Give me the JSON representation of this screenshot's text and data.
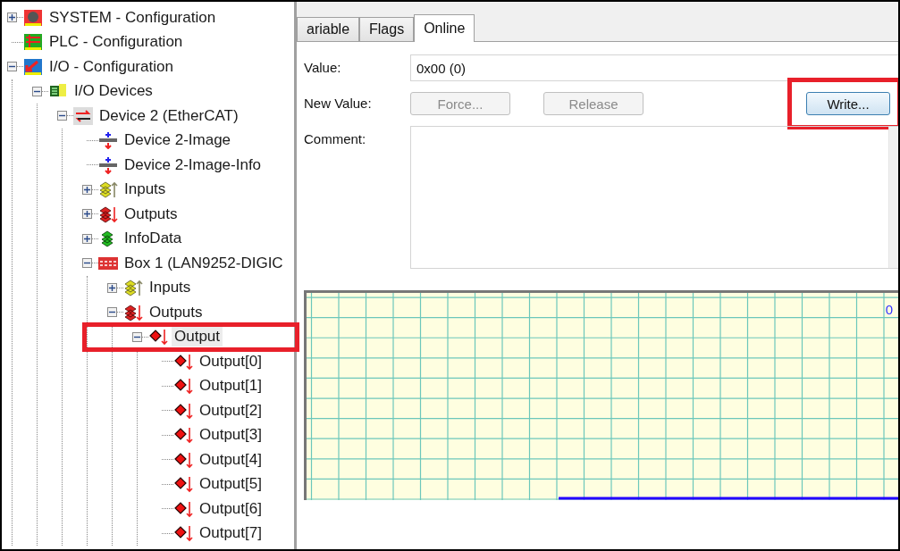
{
  "tree": [
    {
      "label": "SYSTEM - Configuration",
      "kind": "system",
      "expanded": false,
      "selected": false
    },
    {
      "label": "PLC - Configuration",
      "kind": "plc",
      "selected": false
    },
    {
      "label": "I/O - Configuration",
      "kind": "io",
      "expanded": true,
      "selected": false,
      "children": [
        {
          "label": "I/O Devices",
          "kind": "devices",
          "expanded": true,
          "selected": false,
          "children": [
            {
              "label": "Device 2 (EtherCAT)",
              "kind": "ethercat",
              "expanded": true,
              "selected": false,
              "children": [
                {
                  "label": "Device 2-Image",
                  "kind": "image",
                  "selected": false
                },
                {
                  "label": "Device 2-Image-Info",
                  "kind": "image",
                  "selected": false
                },
                {
                  "label": "Inputs",
                  "kind": "inputs",
                  "expanded": false,
                  "selected": false
                },
                {
                  "label": "Outputs",
                  "kind": "outputs",
                  "expanded": false,
                  "selected": false
                },
                {
                  "label": "InfoData",
                  "kind": "infodata",
                  "expanded": false,
                  "selected": false
                },
                {
                  "label": "Box 1 (LAN9252-DIGIC",
                  "kind": "box",
                  "expanded": true,
                  "selected": false,
                  "children": [
                    {
                      "label": "Inputs",
                      "kind": "inputs",
                      "expanded": false,
                      "selected": false
                    },
                    {
                      "label": "Outputs",
                      "kind": "outputs",
                      "expanded": true,
                      "selected": false,
                      "children": [
                        {
                          "label": "Output",
                          "kind": "output-group",
                          "expanded": true,
                          "selected": true,
                          "highlighted": true,
                          "children": [
                            {
                              "label": "Output[0]",
                              "kind": "output-var",
                              "selected": false
                            },
                            {
                              "label": "Output[1]",
                              "kind": "output-var",
                              "selected": false
                            },
                            {
                              "label": "Output[2]",
                              "kind": "output-var",
                              "selected": false
                            },
                            {
                              "label": "Output[3]",
                              "kind": "output-var",
                              "selected": false
                            },
                            {
                              "label": "Output[4]",
                              "kind": "output-var",
                              "selected": false
                            },
                            {
                              "label": "Output[5]",
                              "kind": "output-var",
                              "selected": false
                            },
                            {
                              "label": "Output[6]",
                              "kind": "output-var",
                              "selected": false
                            },
                            {
                              "label": "Output[7]",
                              "kind": "output-var",
                              "selected": false
                            }
                          ]
                        }
                      ]
                    }
                  ]
                }
              ]
            }
          ]
        }
      ]
    }
  ],
  "tabs": [
    {
      "label": "ariable",
      "selected": false
    },
    {
      "label": "Flags",
      "selected": false
    },
    {
      "label": "Online",
      "selected": true
    }
  ],
  "online": {
    "value_label": "Value:",
    "value": "0x00 (0)",
    "new_value_label": "New Value:",
    "buttons": [
      {
        "label": "Force...",
        "disabled": true,
        "highlighted": false
      },
      {
        "label": "Release",
        "disabled": true,
        "highlighted": false
      },
      {
        "label": "Write...",
        "disabled": false,
        "highlighted": true
      }
    ],
    "comment_label": "Comment:"
  },
  "trend": {
    "scale_label": "0"
  }
}
